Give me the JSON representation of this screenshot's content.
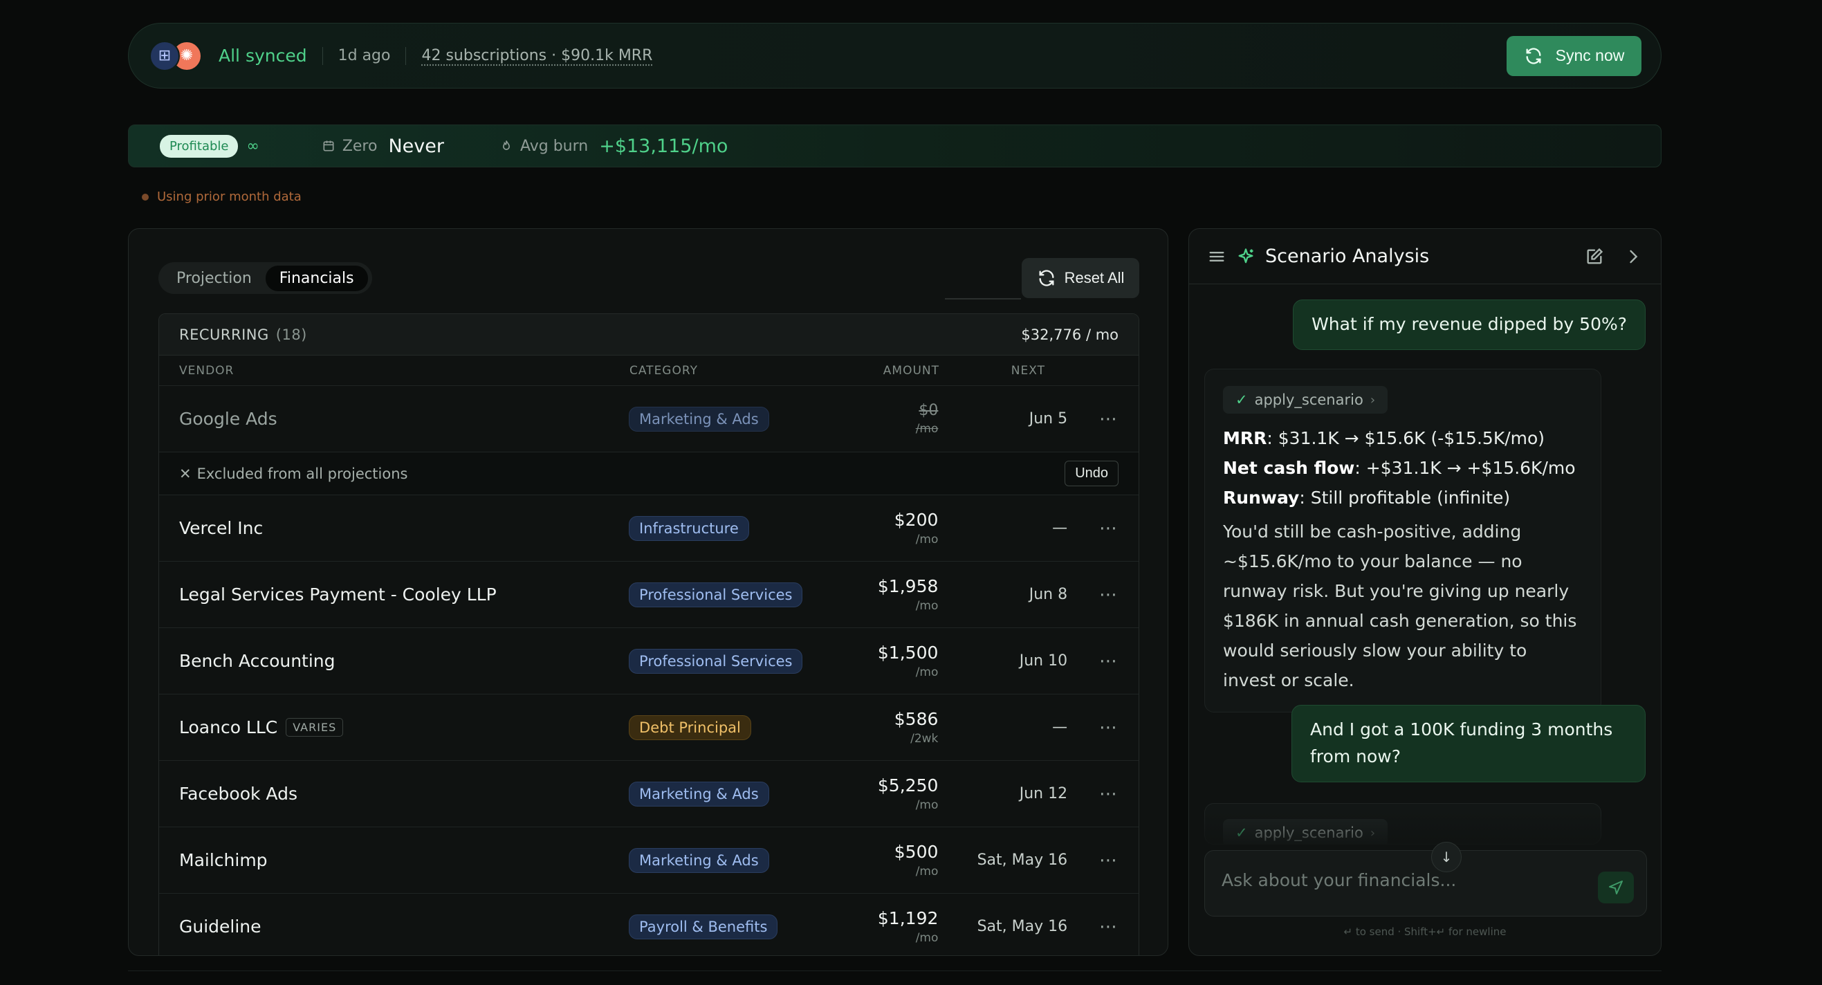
{
  "sync": {
    "status": "All synced",
    "ago": "1d ago",
    "subscriptions": "42 subscriptions · $90.1k MRR",
    "sync_button": "Sync now"
  },
  "strip": {
    "badge": "Profitable",
    "infinity": "∞",
    "zero_label": "Zero",
    "zero_value": "Never",
    "burn_label": "Avg burn",
    "burn_value": "+$13,115/mo"
  },
  "notice": "Using prior month data",
  "left": {
    "tabs": [
      {
        "label": "Projection",
        "active": false
      },
      {
        "label": "Financials",
        "active": true
      }
    ],
    "reset_label": "Reset All",
    "section": {
      "label": "RECURRING",
      "count": "(18)",
      "total": "$32,776 / mo"
    },
    "columns": [
      "VENDOR",
      "CATEGORY",
      "AMOUNT",
      "NEXT"
    ],
    "excluded_note": "Excluded from all projections",
    "undo_label": "Undo",
    "rows": [
      {
        "vendor": "Google Ads",
        "category": "Marketing & Ads",
        "tone": "blue",
        "amount": "$0",
        "unit": "/mo",
        "next": "Jun 5",
        "excluded": true
      },
      {
        "vendor": "Vercel Inc",
        "category": "Infrastructure",
        "tone": "blue",
        "amount": "$200",
        "unit": "/mo",
        "next": "—"
      },
      {
        "vendor": "Legal Services Payment - Cooley LLP",
        "category": "Professional Services",
        "tone": "blue",
        "amount": "$1,958",
        "unit": "/mo",
        "next": "Jun 8"
      },
      {
        "vendor": "Bench Accounting",
        "category": "Professional Services",
        "tone": "blue",
        "amount": "$1,500",
        "unit": "/mo",
        "next": "Jun 10"
      },
      {
        "vendor": "Loanco LLC",
        "tag": "VARIES",
        "category": "Debt Principal",
        "tone": "gold",
        "amount": "$586",
        "unit": "/2wk",
        "next": "—"
      },
      {
        "vendor": "Facebook Ads",
        "category": "Marketing & Ads",
        "tone": "blue",
        "amount": "$5,250",
        "unit": "/mo",
        "next": "Jun 12"
      },
      {
        "vendor": "Mailchimp",
        "category": "Marketing & Ads",
        "tone": "blue",
        "amount": "$500",
        "unit": "/mo",
        "next": "Sat, May 16"
      },
      {
        "vendor": "Guideline",
        "category": "Payroll & Benefits",
        "tone": "blue",
        "amount": "$1,192",
        "unit": "/mo",
        "next": "Sat, May 16"
      }
    ]
  },
  "chat": {
    "title": "Scenario Analysis",
    "q1": "What if my revenue dipped by 50%?",
    "tool": "apply_scenario",
    "lines": [
      {
        "key": "MRR",
        "text": ": $31.1K → $15.6K (-$15.5K/mo)"
      },
      {
        "key": "Net cash flow",
        "text": ": +$31.1K → +$15.6K/mo"
      },
      {
        "key": "Runway",
        "text": ": Still profitable (infinite)"
      }
    ],
    "para": "You'd still be cash-positive, adding ~$15.6K/mo to your balance — no runway risk. But you're giving up nearly $186K in annual cash generation, so this would seriously slow your ability to invest or scale.",
    "q2": "And I got a 100K funding 3 months from now?",
    "tool2": "apply_scenario",
    "placeholder": "Ask about your financials...",
    "hint": "↵ to send · Shift+↵ for newline"
  },
  "colors": {
    "accent": "#4fd18a",
    "sync_button": "#2f8a5c",
    "badge_blue_text": "#9fbdf0",
    "badge_gold_text": "#f0c068"
  }
}
